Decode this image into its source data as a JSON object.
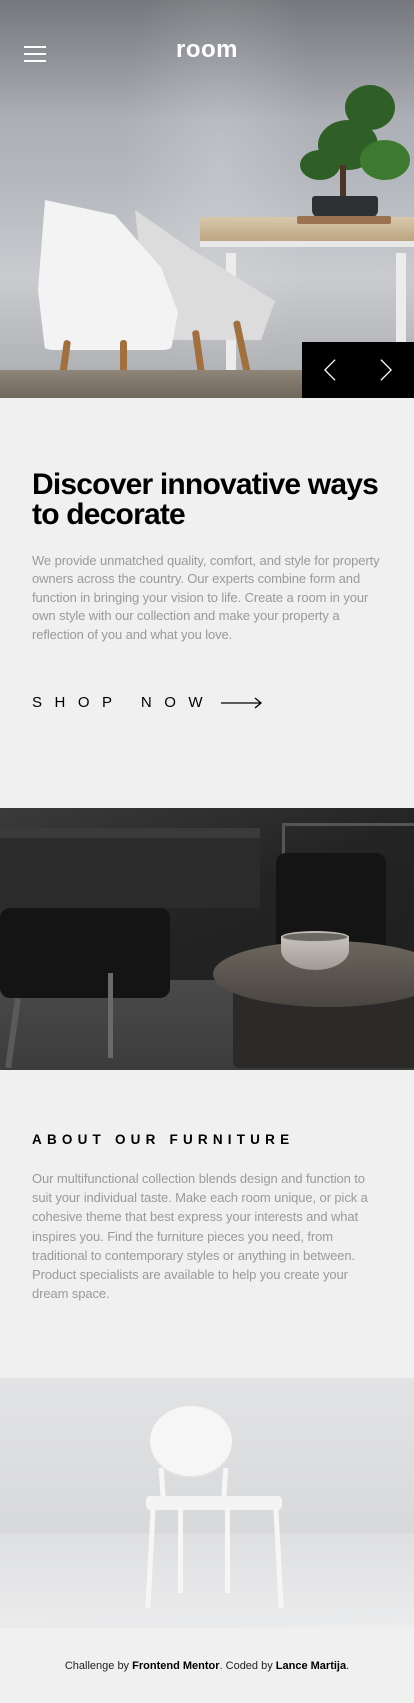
{
  "header": {
    "logo": "room",
    "menu_icon": "hamburger-icon"
  },
  "hero": {
    "prev_icon": "chevron-left-icon",
    "next_icon": "chevron-right-icon"
  },
  "intro": {
    "title": "Discover innovative ways to decorate",
    "body": "We provide unmatched quality, comfort, and style for property owners across the country. Our experts combine form and function in bringing your vision to life. Create a room in your own style with our collection and make your property a reflection of you and what you love.",
    "cta_label": "SHOP NOW",
    "cta_icon": "arrow-right-icon"
  },
  "about": {
    "title": "ABOUT OUR FURNITURE",
    "body": "Our multifunctional collection blends design and function to suit your individual taste. Make each room unique, or pick a cohesive theme that best express your interests and what inspires you. Find the furniture pieces you need, from traditional to contemporary styles or anything in between. Product specialists are available to help you create your dream space."
  },
  "footer": {
    "prefix": "Challenge by ",
    "challenge_link": "Frontend Mentor",
    "middle": ". Coded by ",
    "author_link": "Lance Martija",
    "suffix": "."
  },
  "colors": {
    "background": "#f0f0f0",
    "text_dark": "#000000",
    "text_muted": "#9a9a9a",
    "nav_background": "#000000"
  }
}
